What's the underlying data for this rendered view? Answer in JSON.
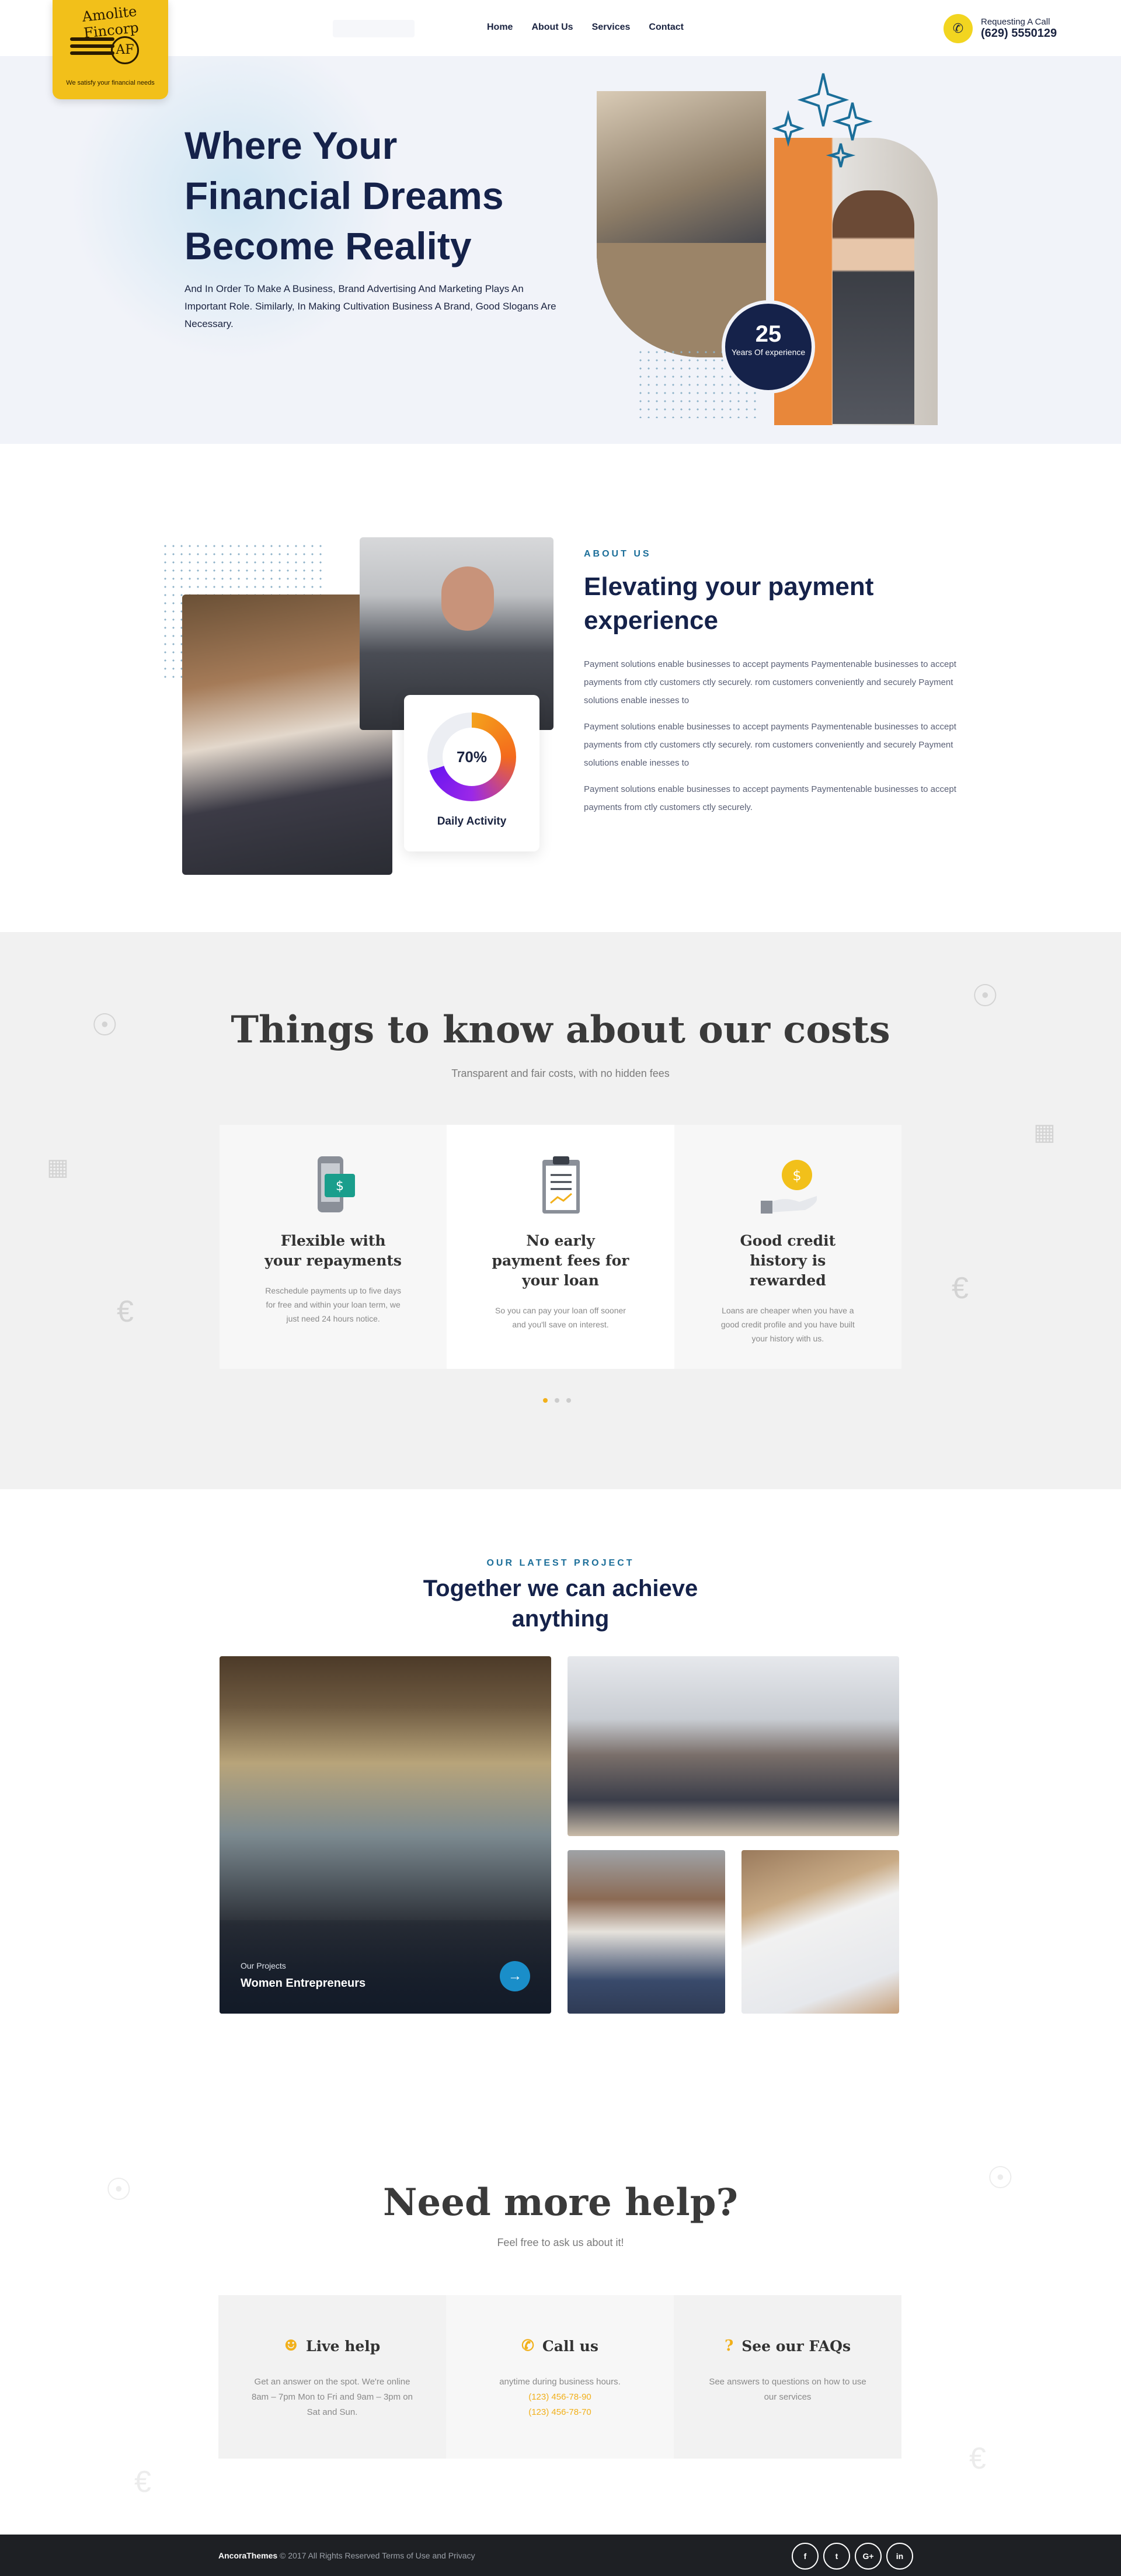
{
  "logo": {
    "arc_text": "Amolite Fincorp",
    "monogram": "AF",
    "tagline": "We satisfy your financial needs"
  },
  "nav": {
    "items": [
      "Home",
      "About Us",
      "Services",
      "Contact"
    ]
  },
  "call": {
    "label": "Requesting A Call",
    "phone": "(629) 5550129",
    "icon": "phone-icon"
  },
  "hero": {
    "title_lines": [
      "Where Your",
      "Financial Dreams",
      "Become Reality"
    ],
    "text": "And In Order To Make A Business, Brand Advertising And Marketing Plays An Important Role. Similarly, In Making Cultivation Business A Brand, Good Slogans Are Necessary.",
    "badge_number": "25",
    "badge_label": "Years Of experience"
  },
  "about": {
    "kicker": "ABOUT US",
    "title": "Elevating your payment experience",
    "paragraphs": [
      "Payment solutions enable businesses to accept payments Paymentenable businesses to accept payments from ctly customers ctly securely. rom customers conveniently and securely Payment solutions enable inesses to",
      "Payment solutions enable businesses to accept payments Paymentenable businesses to accept payments from ctly customers ctly securely. rom customers conveniently and securely Payment solutions enable inesses to",
      "Payment solutions enable businesses to accept payments Paymentenable businesses to accept payments from ctly customers ctly securely."
    ],
    "activity_value": "70%",
    "activity_fraction": 0.7,
    "activity_label": "Daily Activity"
  },
  "costs": {
    "title": "Things to know about our costs",
    "subtitle": "Transparent and fair costs, with no hidden fees",
    "cards": [
      {
        "title": "Flexible with your repayments",
        "text": "Reschedule payments up to five days for free and within your loan term, we just need 24 hours notice.",
        "icon": "phone-dollar-icon"
      },
      {
        "title": "No early payment fees for your loan",
        "text": "So you can pay your loan off sooner and you'll save on interest.",
        "icon": "clipboard-icon"
      },
      {
        "title": "Good credit history is rewarded",
        "text": "Loans are cheaper when you have a good credit profile and you have built your history with us.",
        "icon": "coin-hand-icon"
      }
    ]
  },
  "projects": {
    "kicker": "OUR LATEST PROJECT",
    "title": "Together we can achieve anything",
    "featured_kicker": "Our Projects",
    "featured_title": "Women Entrepreneurs"
  },
  "help": {
    "title": "Need more help?",
    "subtitle": "Feel free to ask us about it!",
    "cards": [
      {
        "title": "Live help",
        "text": "Get an answer on the spot. We're online 8am – 7pm Mon to Fri and 9am – 3pm on Sat and Sun.",
        "icon": "chat-icon"
      },
      {
        "title": "Call us",
        "text": "anytime during business hours.",
        "phones": [
          "(123) 456-78-90",
          "(123) 456-78-70"
        ],
        "icon": "phone-icon"
      },
      {
        "title": "See our FAQs",
        "text": "See answers to questions on how to use our services",
        "icon": "question-icon"
      }
    ]
  },
  "footer": {
    "brand": "AncoraThemes",
    "copyright": "© 2017 All Rights Reserved Terms of Use and Privacy",
    "social": [
      "f",
      "t",
      "G+",
      "in"
    ]
  },
  "colors": {
    "accent": "#f2b01a",
    "navy": "#15224a",
    "blue": "#1a8ec9"
  }
}
